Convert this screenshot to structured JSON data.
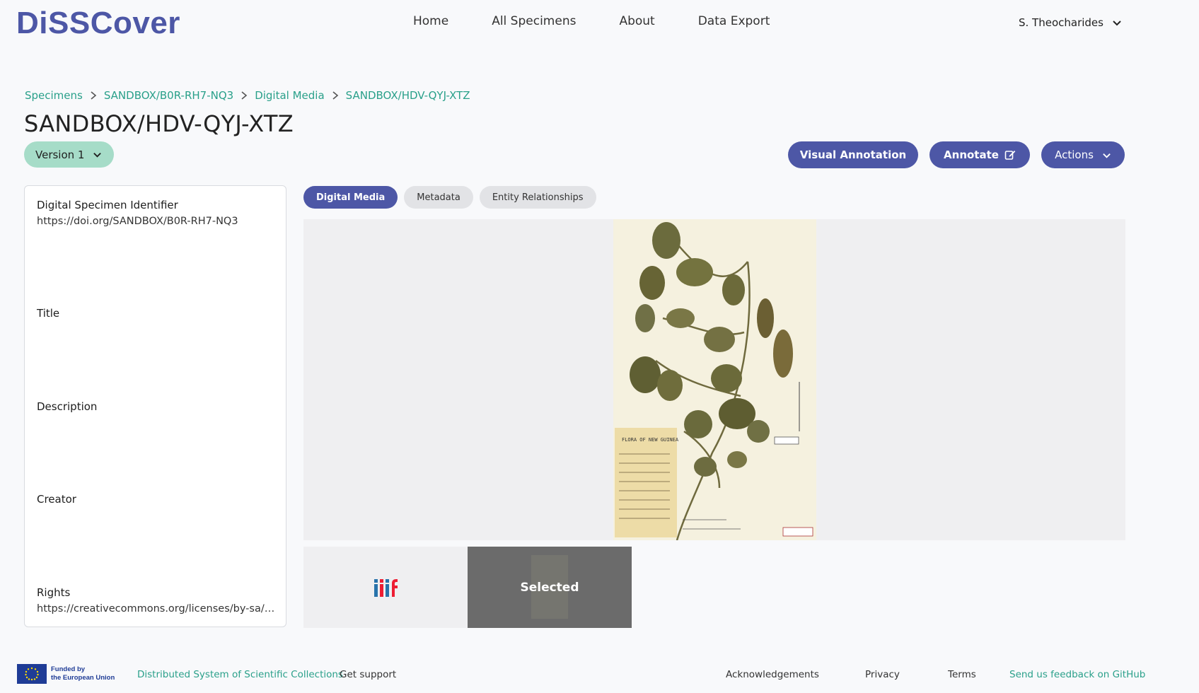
{
  "header": {
    "logo": "DiSSCover",
    "nav": [
      "Home",
      "All Specimens",
      "About",
      "Data Export"
    ],
    "user": "S. Theocharides"
  },
  "breadcrumb": [
    "Specimens",
    "SANDBOX/B0R-RH7-NQ3",
    "Digital Media",
    "SANDBOX/HDV-QYJ-XTZ"
  ],
  "page_title": "SANDBOX/HDV-QYJ-XTZ",
  "version_label": "Version 1",
  "buttons": {
    "visual_annotation": "Visual Annotation",
    "annotate": "Annotate",
    "actions": "Actions"
  },
  "details": [
    {
      "label": "Digital Specimen Identifier",
      "value": "https://doi.org/SANDBOX/B0R-RH7-NQ3"
    },
    {
      "label": "Title",
      "value": ""
    },
    {
      "label": "Description",
      "value": ""
    },
    {
      "label": "Creator",
      "value": ""
    },
    {
      "label": "Rights",
      "value": "https://creativecommons.org/licenses/by-sa/3...."
    }
  ],
  "tabs": [
    "Digital Media",
    "Metadata",
    "Entity Relationships"
  ],
  "thumbnails": {
    "selected_label": "Selected"
  },
  "footer": {
    "eu_text_line1": "Funded by",
    "eu_text_line2": "the European Union",
    "links": [
      "Distributed System of Scientific Collections",
      "Get support",
      "Acknowledgements",
      "Privacy",
      "Terms",
      "Send us feedback on GitHub"
    ]
  },
  "colors": {
    "primary": "#4d57a6",
    "accent": "#2aa08a",
    "version_bg": "#a6dcc8"
  }
}
